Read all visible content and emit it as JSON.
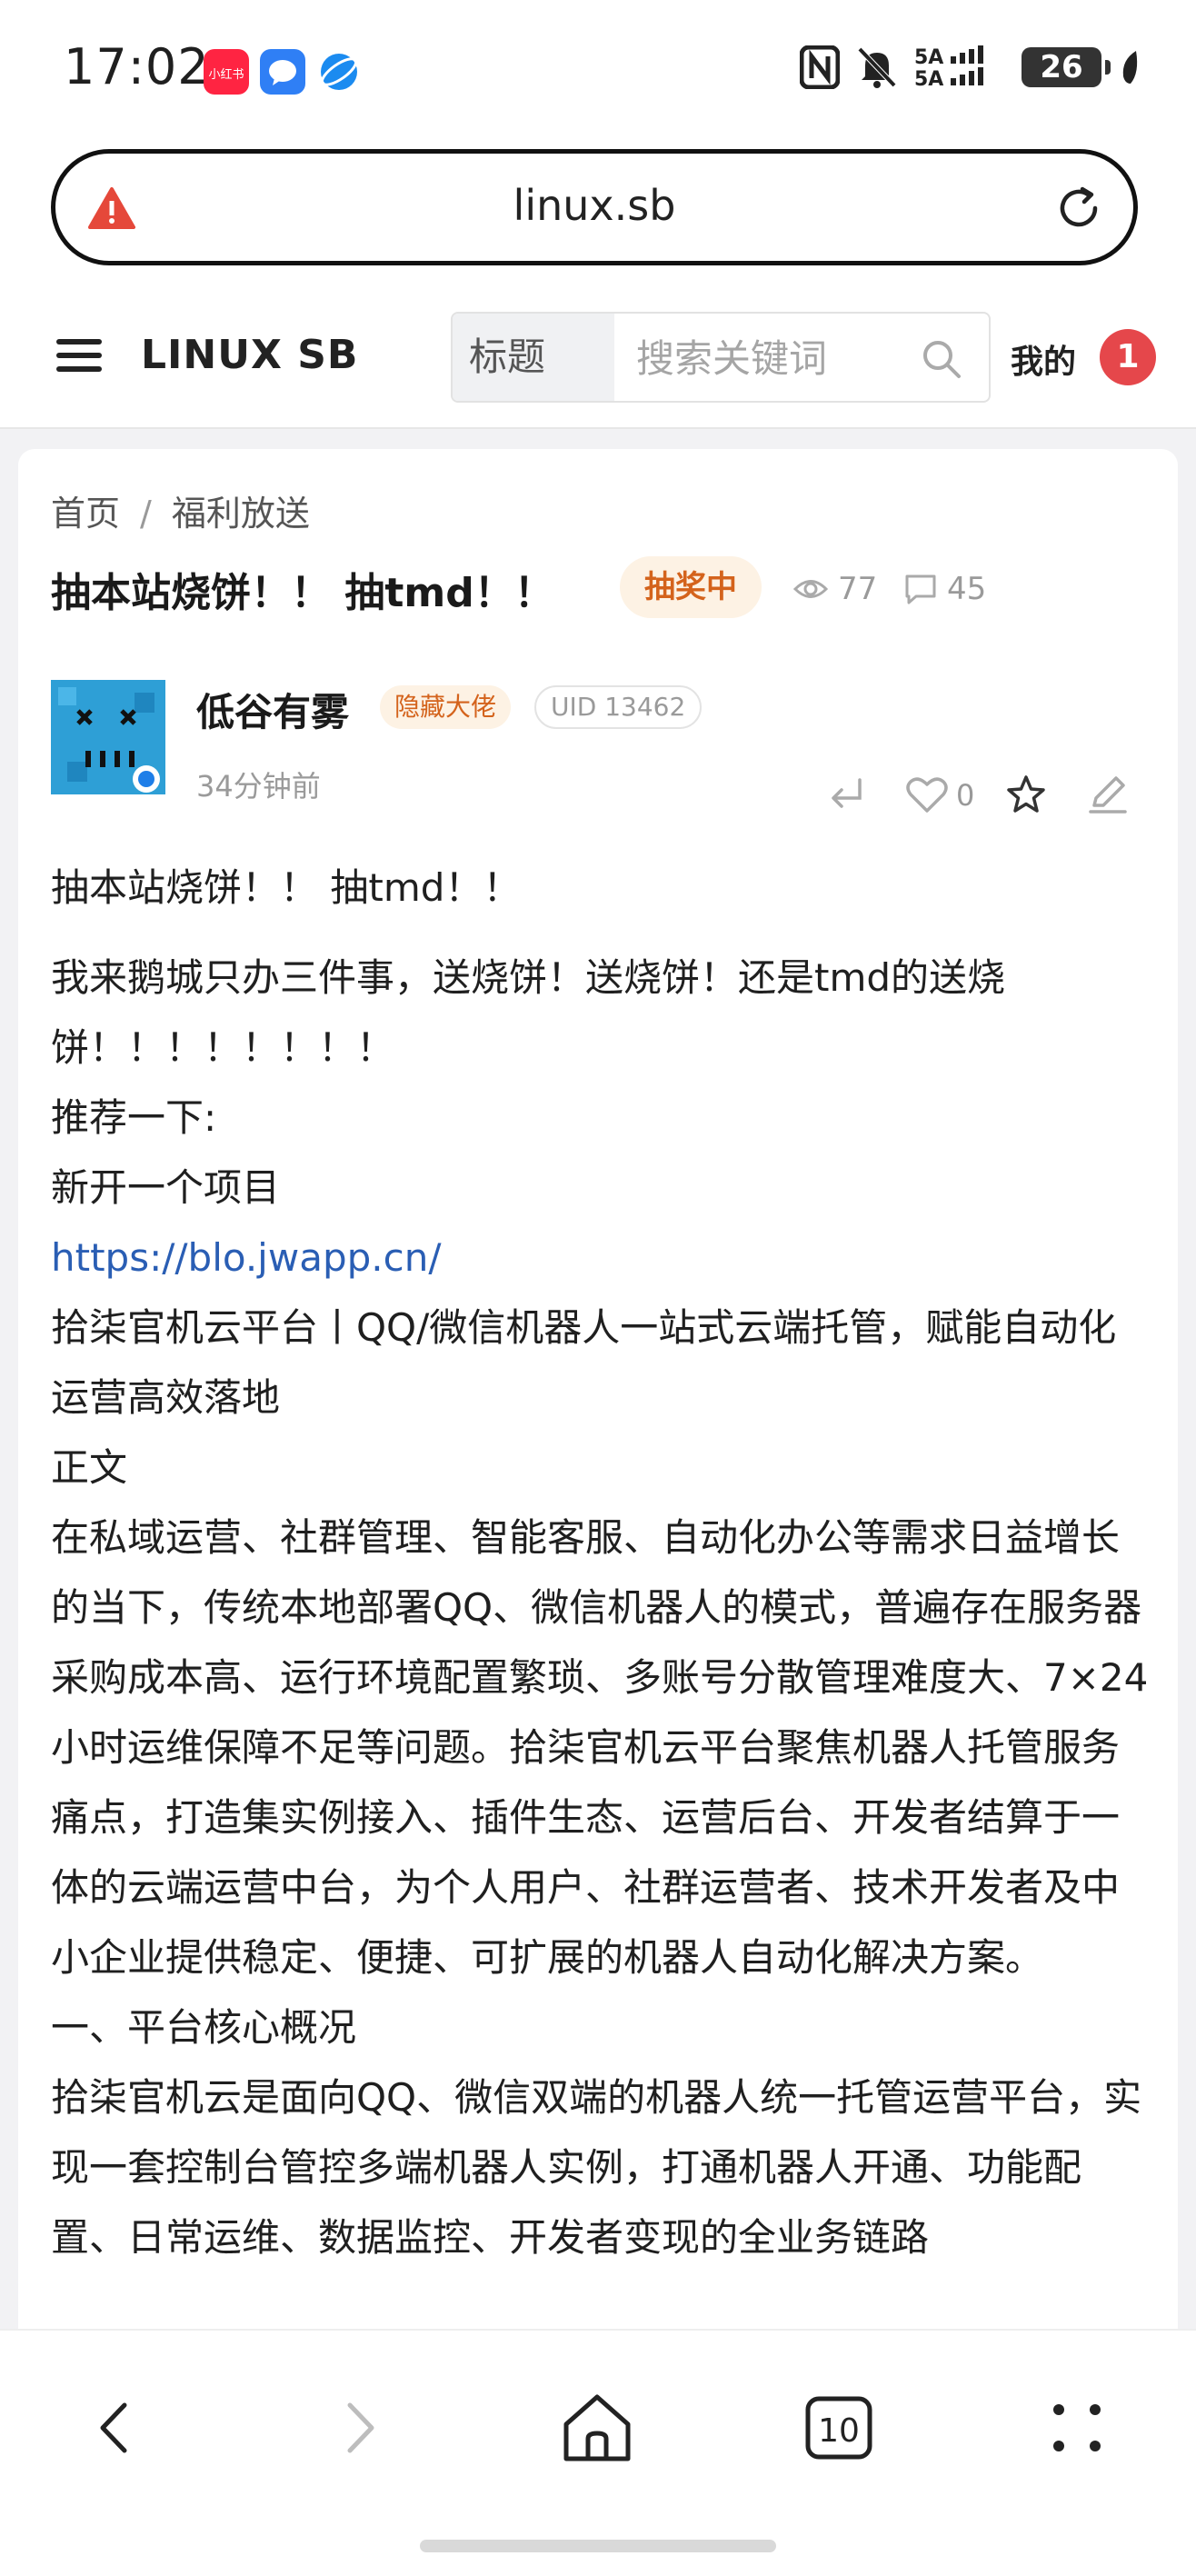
{
  "status_bar": {
    "time": "17:02",
    "app_icons": [
      "xiaohongshu-icon",
      "messages-icon",
      "browser-icon"
    ],
    "network": "5A 5A",
    "battery": "26"
  },
  "url_bar": {
    "url": "linux.sb"
  },
  "site_header": {
    "title": "LINUX SB",
    "search_category": "标题",
    "search_placeholder": "搜索关键词",
    "mine_label": "我的",
    "notification_count": "1"
  },
  "post": {
    "breadcrumb": [
      "首页",
      "福利放送"
    ],
    "breadcrumb_sep": "/",
    "title": "抽本站烧饼！！ 抽tmd！！",
    "status_badge": "抽奖中",
    "views": "77",
    "comments": "45",
    "author": {
      "name": "低谷有雾",
      "tag": "隐藏大佬",
      "uid": "UID 13462",
      "time": "34分钟前"
    },
    "likes": "0",
    "content": [
      "抽本站烧饼！！ 抽tmd！！",
      "我来鹅城只办三件事，送烧饼！送烧饼！还是tmd的送烧饼！！！！！！！！",
      "推荐一下:",
      "新开一个项目",
      "https://blo.jwapp.cn/",
      "拾柒官机云平台丨QQ/微信机器人一站式云端托管，赋能自动化运营高效落地",
      "正文",
      "在私域运营、社群管理、智能客服、自动化办公等需求日益增长的当下，传统本地部署QQ、微信机器人的模式，普遍存在服务器采购成本高、运行环境配置繁琐、多账号分散管理难度大、7×24小时运维保障不足等问题。拾柒官机云平台聚焦机器人托管服务痛点，打造集实例接入、插件生态、运营后台、开发者结算于一体的云端运营中台，为个人用户、社群运营者、技术开发者及中小企业提供稳定、便捷、可扩展的机器人自动化解决方案。",
      "一、平台核心概况",
      "拾柒官机云是面向QQ、微信双端的机器人统一托管运营平台，实现一套控制台管控多端机器人实例，打通机器人开通、功能配置、日常运维、数据监控、开发者变现的全业务链路"
    ]
  },
  "bottom_nav": {
    "tabs_count": "10"
  },
  "colors": {
    "accent_red": "#e5474b",
    "badge_orange": "#d4631c",
    "link_blue": "#2a5eb4"
  }
}
